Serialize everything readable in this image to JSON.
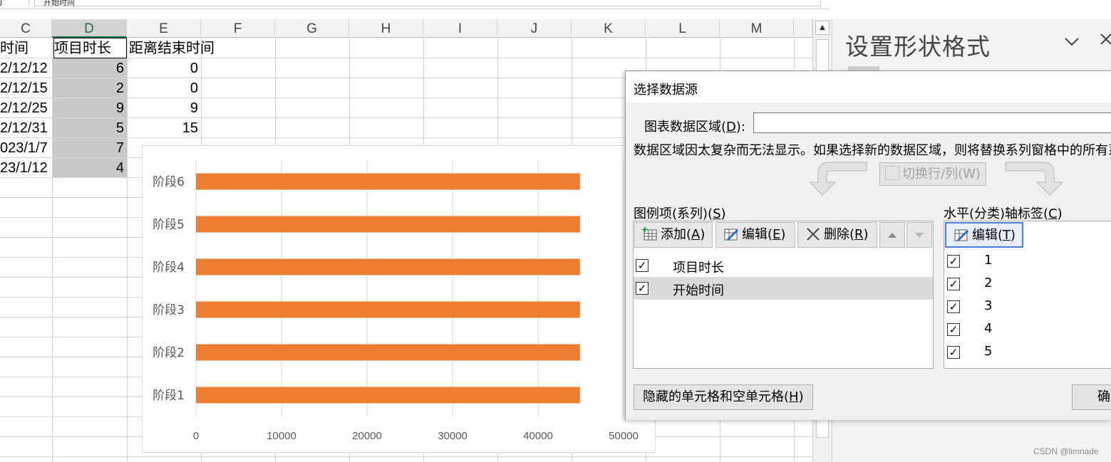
{
  "formula_bar": {
    "left_text": "j",
    "value": "开始时间"
  },
  "columns": [
    "C",
    "D",
    "E",
    "F",
    "G",
    "H",
    "I",
    "J",
    "K",
    "L",
    "M"
  ],
  "selected_column": "D",
  "sheet": {
    "headers": {
      "c": "时间",
      "d": "项目时长",
      "e": "距离结束时间"
    },
    "rows": [
      {
        "c": "2/12/12",
        "d": "6",
        "e": "0"
      },
      {
        "c": "2/12/15",
        "d": "2",
        "e": "0"
      },
      {
        "c": "2/12/25",
        "d": "9",
        "e": "9"
      },
      {
        "c": "2/12/31",
        "d": "5",
        "e": "15"
      },
      {
        "c": "023/1/7",
        "d": "7",
        "e": ""
      },
      {
        "c": "23/1/12",
        "d": "4",
        "e": ""
      }
    ]
  },
  "chart_data": {
    "type": "bar",
    "orientation": "horizontal",
    "categories": [
      "阶段1",
      "阶段2",
      "阶段3",
      "阶段4",
      "阶段5",
      "阶段6"
    ],
    "series": [
      {
        "values": [
          44900,
          44900,
          44900,
          44900,
          44900,
          44900
        ],
        "color": "#ED7D31"
      }
    ],
    "xlim": [
      0,
      50000
    ],
    "xticks": [
      "0",
      "10000",
      "20000",
      "30000",
      "40000",
      "50000"
    ],
    "grid": true,
    "title": "",
    "xlabel": "",
    "ylabel": ""
  },
  "side_pane": {
    "title": "设置形状格式",
    "chevron_icon": "chevron-down-icon",
    "close_icon": "close-icon"
  },
  "dialog": {
    "title": "选择数据源",
    "range_label_prefix": "图表数据区域(",
    "range_label_key": "D",
    "range_label_suffix": "):",
    "range_value": "",
    "message": "数据区域因太复杂而无法显示。如果选择新的数据区域，则将替换系列窗格中的所有系",
    "switch_button": "切换行/列(W)",
    "legend_header_prefix": "图例项(系列)(",
    "legend_header_key": "S",
    "legend_header_suffix": ")",
    "add_prefix": "添加(",
    "add_key": "A",
    "add_suffix": ")",
    "edit_prefix": "编辑(",
    "edit_key": "E",
    "edit_suffix": ")",
    "delete_prefix": "删除(",
    "delete_key": "R",
    "delete_suffix": ")",
    "series": [
      {
        "name": "项目时长",
        "checked": true,
        "selected": false
      },
      {
        "name": "开始时间",
        "checked": true,
        "selected": true
      }
    ],
    "axis_header_prefix": "水平(分类)轴标签(",
    "axis_header_key": "C",
    "axis_header_suffix": ")",
    "axis_edit_prefix": "编辑(",
    "axis_edit_key": "T",
    "axis_edit_suffix": ")",
    "axis_labels": [
      "1",
      "2",
      "3",
      "4",
      "5"
    ],
    "hidden_cells_prefix": "隐藏的单元格和空单元格(",
    "hidden_cells_key": "H",
    "hidden_cells_suffix": ")",
    "ok_label": "确"
  },
  "watermark": "CSDN @limnade"
}
